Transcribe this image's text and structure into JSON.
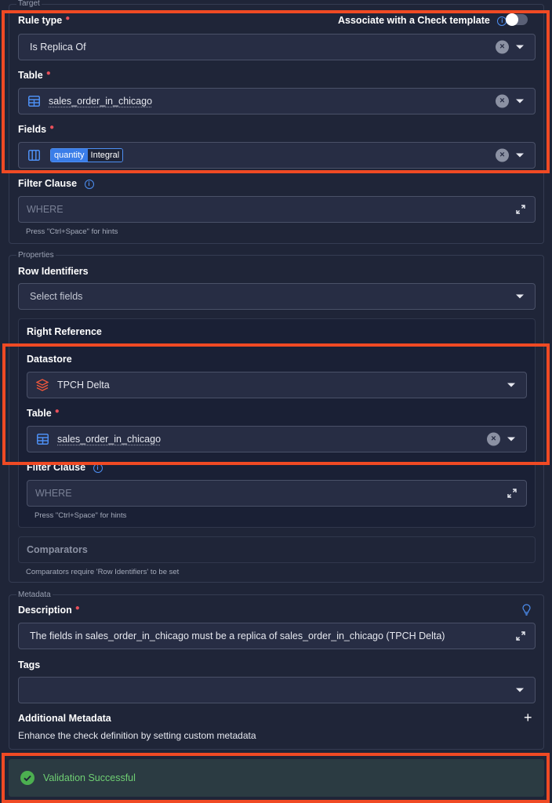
{
  "target": {
    "legend": "Target",
    "rule_type": {
      "label": "Rule type",
      "value": "Is Replica Of"
    },
    "check_template": {
      "label": "Associate with a Check template"
    },
    "table": {
      "label": "Table",
      "value": "sales_order_in_chicago"
    },
    "fields": {
      "label": "Fields",
      "chip_name": "quantity",
      "chip_type": "Integral"
    },
    "filter": {
      "label": "Filter Clause",
      "placeholder": "WHERE",
      "hint": "Press \"Ctrl+Space\" for hints"
    }
  },
  "properties": {
    "legend": "Properties",
    "row_identifiers": {
      "label": "Row Identifiers",
      "placeholder": "Select fields"
    },
    "right_reference": {
      "title": "Right Reference",
      "datastore": {
        "label": "Datastore",
        "value": "TPCH Delta"
      },
      "table": {
        "label": "Table",
        "value": "sales_order_in_chicago"
      },
      "filter": {
        "label": "Filter Clause",
        "placeholder": "WHERE",
        "hint": "Press \"Ctrl+Space\" for hints"
      }
    },
    "comparators": {
      "title": "Comparators",
      "hint": "Comparators require 'Row Identifiers' to be set"
    }
  },
  "metadata": {
    "legend": "Metadata",
    "description": {
      "label": "Description",
      "value": "The fields in sales_order_in_chicago must be a replica of sales_order_in_chicago (TPCH Delta)"
    },
    "tags": {
      "label": "Tags"
    },
    "additional": {
      "label": "Additional Metadata",
      "subtitle": "Enhance the check definition by setting custom metadata"
    }
  },
  "validation": {
    "message": "Validation Successful"
  },
  "colors": {
    "accent": "#4d8ff2",
    "highlight": "#f04a24",
    "success": "#4caf50",
    "required": "#e8505b"
  }
}
